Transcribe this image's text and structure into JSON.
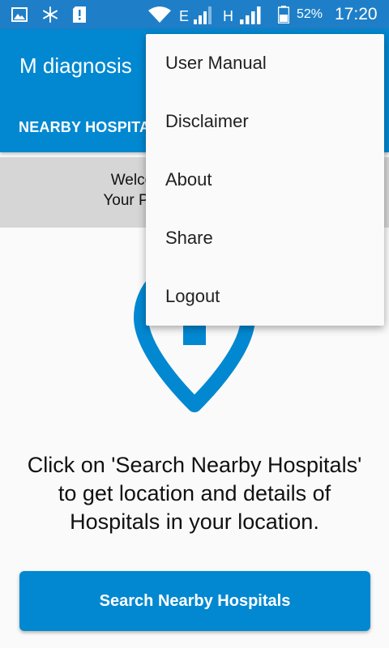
{
  "status_bar": {
    "left_icons": [
      "image-icon",
      "snowflake-icon",
      "sim-alert-icon"
    ],
    "right_icons": [
      "wifi-icon",
      "signal-icon",
      "signal-icon",
      "battery-icon"
    ],
    "network_1": "E",
    "network_2": "H",
    "battery_percent": "52%",
    "time": "17:20"
  },
  "toolbar": {
    "title": "M diagnosis",
    "tab_label": "NEARBY HOSPITALS"
  },
  "welcome": {
    "line1": "Welcome to M diagnosis",
    "line2": "Your Personal Health Care"
  },
  "main": {
    "icon": "hospital-location-pin-icon",
    "info_text": "Click on 'Search Nearby Hospitals' to get location and details of Hospitals in your location.",
    "search_button_label": "Search Nearby Hospitals"
  },
  "overflow_menu": {
    "items": [
      {
        "label": "User Manual"
      },
      {
        "label": "Disclaimer"
      },
      {
        "label": "About"
      },
      {
        "label": "Share"
      },
      {
        "label": "Logout"
      }
    ]
  },
  "colors": {
    "status_bar": "#1e7fc8",
    "primary": "#0288d1",
    "banner": "#d6d6d6",
    "background": "#fafafa"
  }
}
